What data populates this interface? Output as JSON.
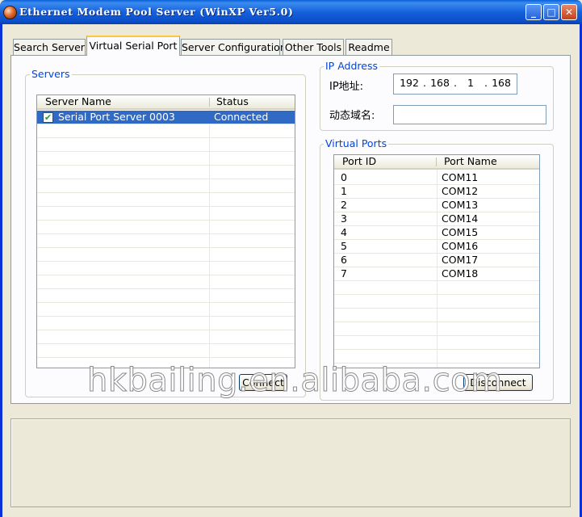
{
  "window": {
    "title": "Ethernet Modem Pool Server (WinXP Ver5.0)",
    "controls": {
      "minimize": "_",
      "maximize": "□",
      "close": "✕"
    }
  },
  "tabs": [
    {
      "label": "Search Server",
      "active": false
    },
    {
      "label": "Virtual Serial Port",
      "active": true
    },
    {
      "label": "Server Configuration",
      "active": false
    },
    {
      "label": "Other Tools",
      "active": false
    },
    {
      "label": "Readme",
      "active": false
    }
  ],
  "servers": {
    "legend": "Servers",
    "columns": [
      "Server Name",
      "Status"
    ],
    "rows": [
      {
        "name": "Serial Port Server 0003",
        "status": "Connected",
        "checked": true,
        "selected": true
      }
    ],
    "button_label": "Connect"
  },
  "ip_address": {
    "legend": "IP Address",
    "ip_label": "IP地址:",
    "ip_segments": [
      "192",
      "168",
      "1",
      "168"
    ],
    "domain_label": "动态域名:",
    "domain_value": ""
  },
  "virtual_ports": {
    "legend": "Virtual Ports",
    "columns": [
      "Port ID",
      "Port Name"
    ],
    "rows": [
      {
        "id": "0",
        "name": "COM11"
      },
      {
        "id": "1",
        "name": "COM12"
      },
      {
        "id": "2",
        "name": "COM13"
      },
      {
        "id": "3",
        "name": "COM14"
      },
      {
        "id": "4",
        "name": "COM15"
      },
      {
        "id": "5",
        "name": "COM16"
      },
      {
        "id": "6",
        "name": "COM17"
      },
      {
        "id": "7",
        "name": "COM18"
      }
    ],
    "button_label": "Disconnect"
  },
  "watermark": "hkbailing.en.alibaba.com",
  "colors": {
    "titlebar": "#0a5fd8",
    "selection": "#316ac5",
    "legend": "#0046d5",
    "active_tab_accent": "#ffc83c"
  }
}
